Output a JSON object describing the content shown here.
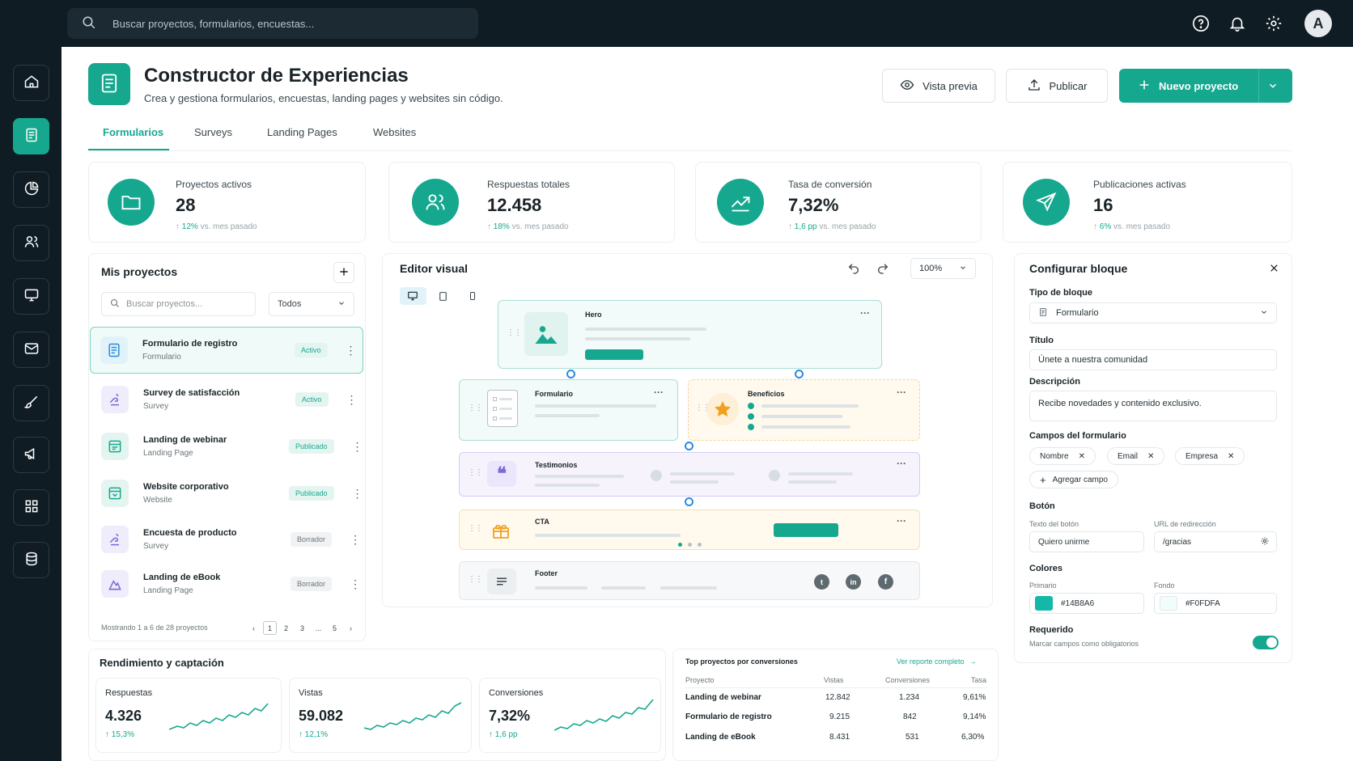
{
  "search": {
    "placeholder": "Buscar proyectos, formularios, encuestas..."
  },
  "user": {
    "avatar_initial": "A"
  },
  "header": {
    "title": "Constructor de Experiencias",
    "subtitle": "Crea y gestiona formularios, encuestas, landing pages y websites sin código.",
    "preview_label": "Vista previa",
    "publish_label": "Publicar",
    "new_project_label": "Nuevo proyecto"
  },
  "tabs": [
    {
      "label": "Formularios",
      "active": true
    },
    {
      "label": "Surveys"
    },
    {
      "label": "Landing Pages"
    },
    {
      "label": "Websites"
    }
  ],
  "stats": [
    {
      "label": "Proyectos activos",
      "value": "28",
      "delta": "12%",
      "delta_note": "vs. mes pasado",
      "icon": "folder-icon"
    },
    {
      "label": "Respuestas totales",
      "value": "12.458",
      "delta": "18%",
      "delta_note": "vs. mes pasado",
      "icon": "users-icon"
    },
    {
      "label": "Tasa de conversión",
      "value": "7,32%",
      "delta": "1,6 pp",
      "delta_note": "vs. mes pasado",
      "icon": "trend-icon"
    },
    {
      "label": "Publicaciones activas",
      "value": "16",
      "delta": "6%",
      "delta_note": "vs. mes pasado",
      "icon": "send-icon"
    }
  ],
  "projects": {
    "title": "Mis proyectos",
    "search_placeholder": "Buscar proyectos...",
    "filter": "Todos",
    "items": [
      {
        "name": "Formulario de registro",
        "type": "Formulario",
        "status": "Activo"
      },
      {
        "name": "Survey de satisfacción",
        "type": "Survey",
        "status": "Activo"
      },
      {
        "name": "Landing de webinar",
        "type": "Landing Page",
        "status": "Publicado"
      },
      {
        "name": "Website corporativo",
        "type": "Website",
        "status": "Publicado"
      },
      {
        "name": "Encuesta de producto",
        "type": "Survey",
        "status": "Borrador"
      },
      {
        "name": "Landing de eBook",
        "type": "Landing Page",
        "status": "Borrador"
      }
    ],
    "footer": "Mostrando 1 a 6 de 28 proyectos",
    "pages": [
      "1",
      "2",
      "3",
      "...",
      "5"
    ]
  },
  "editor": {
    "title": "Editor visual",
    "zoom": "100%",
    "blocks": {
      "hero": "Hero",
      "form": "Formulario",
      "benefits": "Beneficios",
      "testimonials": "Testimonios",
      "cta": "CTA",
      "footer": "Footer"
    }
  },
  "config": {
    "title": "Configurar bloque",
    "block_type_label": "Tipo de bloque",
    "block_type_value": "Formulario",
    "title_label": "Título",
    "title_value": "Únete a nuestra comunidad",
    "description_label": "Descripción",
    "description_value": "Recibe novedades y contenido exclusivo.",
    "fields_label": "Campos del formulario",
    "fields": [
      "Nombre",
      "Email",
      "Empresa"
    ],
    "add_field": "Agregar campo",
    "button_label": "Botón",
    "button_text_label": "Texto del botón",
    "button_text_value": "Quiero unirme",
    "redirect_label": "URL de redirección",
    "redirect_value": "/gracias",
    "colors_label": "Colores",
    "primary_label": "Primario",
    "primary_value": "#14B8A6",
    "background_label": "Fondo",
    "background_value": "#F0FDFA",
    "required_label": "Requerido",
    "required_note": "Marcar campos como obligatorios",
    "required_on": true
  },
  "performance": {
    "title": "Rendimiento y captación",
    "kpis": [
      {
        "label": "Respuestas",
        "value": "4.326",
        "delta": "15,3%"
      },
      {
        "label": "Vistas",
        "value": "59.082",
        "delta": "12,1%"
      },
      {
        "label": "Conversiones",
        "value": "7,32%",
        "delta": "1,6 pp"
      }
    ]
  },
  "top_projects": {
    "title": "Top proyectos por conversiones",
    "link": "Ver reporte completo",
    "columns": [
      "Proyecto",
      "Vistas",
      "Conversiones",
      "Tasa"
    ],
    "rows": [
      [
        "Landing de webinar",
        "12.842",
        "1.234",
        "9,61%"
      ],
      [
        "Formulario de registro",
        "9.215",
        "842",
        "9,14%"
      ],
      [
        "Landing de eBook",
        "8.431",
        "531",
        "6,30%"
      ]
    ]
  },
  "colors": {
    "accent": "#16a88f",
    "topbar": "#0f1c24"
  }
}
